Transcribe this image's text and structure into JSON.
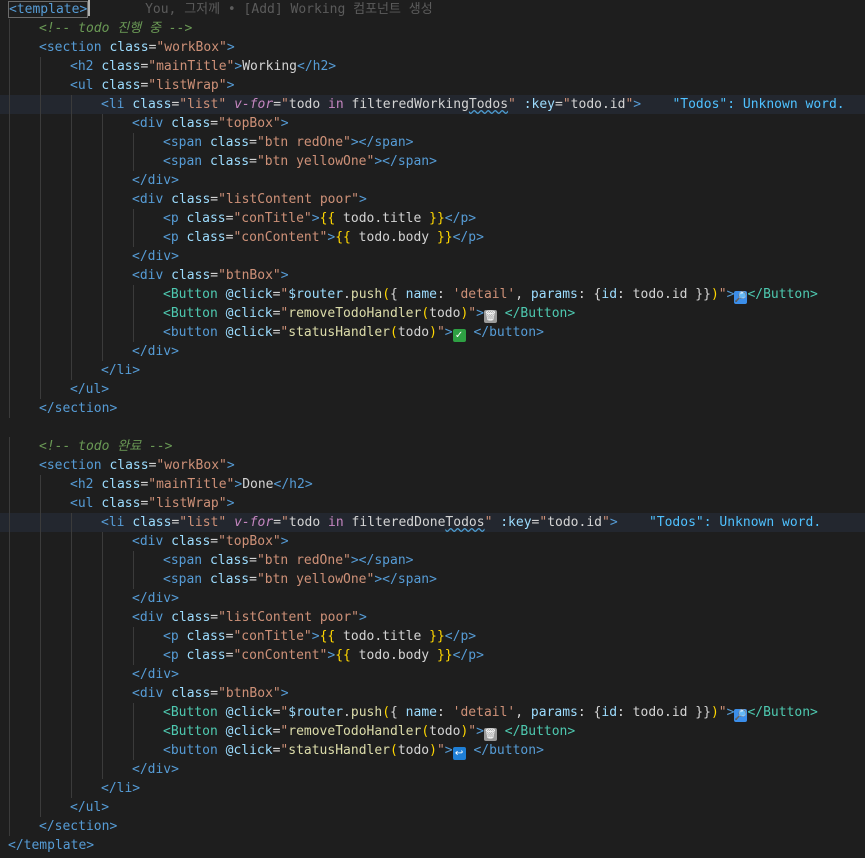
{
  "editor": {
    "blame": "You, 그저께 • [Add] Working 컴포넌트 생성",
    "diagnostic_working": "\"Todos\": Unknown word.",
    "diagnostic_done": "\"Todos\": Unknown word."
  },
  "lines": [
    {
      "indent": 0,
      "tokens": [
        [
          "tagb",
          "<template>"
        ],
        [
          "cursor",
          ""
        ],
        [
          "ghost",
          "       You, 그저께 • [Add] Working 컴포넌트 생성"
        ]
      ]
    },
    {
      "indent": 1,
      "tokens": [
        [
          "cmt",
          "<!-- todo 진행 중 -->"
        ]
      ]
    },
    {
      "indent": 1,
      "tokens": [
        [
          "tag",
          "<section"
        ],
        [
          "txt",
          " "
        ],
        [
          "attr",
          "class"
        ],
        [
          "txt",
          "="
        ],
        [
          "str",
          "\"workBox\""
        ],
        [
          "tag",
          ">"
        ]
      ]
    },
    {
      "indent": 2,
      "tokens": [
        [
          "tag",
          "<h2"
        ],
        [
          "txt",
          " "
        ],
        [
          "attr",
          "class"
        ],
        [
          "txt",
          "="
        ],
        [
          "str",
          "\"mainTitle\""
        ],
        [
          "tag",
          ">"
        ],
        [
          "txt",
          "Working"
        ],
        [
          "tag",
          "</h2>"
        ]
      ]
    },
    {
      "indent": 2,
      "tokens": [
        [
          "tag",
          "<ul"
        ],
        [
          "txt",
          " "
        ],
        [
          "attr",
          "class"
        ],
        [
          "txt",
          "="
        ],
        [
          "str",
          "\"listWrap\""
        ],
        [
          "tag",
          ">"
        ]
      ]
    },
    {
      "indent": 3,
      "hl": true,
      "tokens": [
        [
          "tag",
          "<li"
        ],
        [
          "txt",
          " "
        ],
        [
          "attr",
          "class"
        ],
        [
          "txt",
          "="
        ],
        [
          "str",
          "\"list\""
        ],
        [
          "txt",
          " "
        ],
        [
          "dir",
          "v-for"
        ],
        [
          "txt",
          "="
        ],
        [
          "str",
          "\""
        ],
        [
          "txt",
          "todo "
        ],
        [
          "kw",
          "in"
        ],
        [
          "txt",
          " filteredWorking"
        ],
        [
          "wavy",
          "Todos"
        ],
        [
          "str",
          "\""
        ],
        [
          "txt",
          " "
        ],
        [
          "attr",
          ":key"
        ],
        [
          "txt",
          "="
        ],
        [
          "str",
          "\""
        ],
        [
          "txt",
          "todo.id"
        ],
        [
          "str",
          "\""
        ],
        [
          "tag",
          ">"
        ],
        [
          "txt",
          "    "
        ],
        [
          "diag",
          "\"Todos\": Unknown word."
        ]
      ]
    },
    {
      "indent": 4,
      "tokens": [
        [
          "tag",
          "<div"
        ],
        [
          "txt",
          " "
        ],
        [
          "attr",
          "class"
        ],
        [
          "txt",
          "="
        ],
        [
          "str",
          "\"topBox\""
        ],
        [
          "tag",
          ">"
        ]
      ]
    },
    {
      "indent": 5,
      "tokens": [
        [
          "tag",
          "<span"
        ],
        [
          "txt",
          " "
        ],
        [
          "attr",
          "class"
        ],
        [
          "txt",
          "="
        ],
        [
          "str",
          "\"btn redOne\""
        ],
        [
          "tag",
          "></span>"
        ]
      ]
    },
    {
      "indent": 5,
      "tokens": [
        [
          "tag",
          "<span"
        ],
        [
          "txt",
          " "
        ],
        [
          "attr",
          "class"
        ],
        [
          "txt",
          "="
        ],
        [
          "str",
          "\"btn yellowOne\""
        ],
        [
          "tag",
          "></span>"
        ]
      ]
    },
    {
      "indent": 4,
      "tokens": [
        [
          "tag",
          "</div>"
        ]
      ]
    },
    {
      "indent": 4,
      "tokens": [
        [
          "tag",
          "<div"
        ],
        [
          "txt",
          " "
        ],
        [
          "attr",
          "class"
        ],
        [
          "txt",
          "="
        ],
        [
          "str",
          "\"listContent poor\""
        ],
        [
          "tag",
          ">"
        ]
      ]
    },
    {
      "indent": 5,
      "tokens": [
        [
          "tag",
          "<p"
        ],
        [
          "txt",
          " "
        ],
        [
          "attr",
          "class"
        ],
        [
          "txt",
          "="
        ],
        [
          "str",
          "\"conTitle\""
        ],
        [
          "tag",
          ">"
        ],
        [
          "brace",
          "{{"
        ],
        [
          "txt",
          " todo.title "
        ],
        [
          "brace",
          "}}"
        ],
        [
          "tag",
          "</p>"
        ]
      ]
    },
    {
      "indent": 5,
      "tokens": [
        [
          "tag",
          "<p"
        ],
        [
          "txt",
          " "
        ],
        [
          "attr",
          "class"
        ],
        [
          "txt",
          "="
        ],
        [
          "str",
          "\"conContent\""
        ],
        [
          "tag",
          ">"
        ],
        [
          "brace",
          "{{"
        ],
        [
          "txt",
          " todo.body "
        ],
        [
          "brace",
          "}}"
        ],
        [
          "tag",
          "</p>"
        ]
      ]
    },
    {
      "indent": 4,
      "tokens": [
        [
          "tag",
          "</div>"
        ]
      ]
    },
    {
      "indent": 4,
      "tokens": [
        [
          "tag",
          "<div"
        ],
        [
          "txt",
          " "
        ],
        [
          "attr",
          "class"
        ],
        [
          "txt",
          "="
        ],
        [
          "str",
          "\"btnBox\""
        ],
        [
          "tag",
          ">"
        ]
      ]
    },
    {
      "indent": 5,
      "tokens": [
        [
          "btag",
          "<Button"
        ],
        [
          "txt",
          " "
        ],
        [
          "attr",
          "@click"
        ],
        [
          "txt",
          "="
        ],
        [
          "str",
          "\""
        ],
        [
          "var",
          "$router"
        ],
        [
          "txt",
          "."
        ],
        [
          "fn",
          "push"
        ],
        [
          "brace",
          "("
        ],
        [
          "txt",
          "{ "
        ],
        [
          "attr",
          "name"
        ],
        [
          "txt",
          ": "
        ],
        [
          "str",
          "'detail'"
        ],
        [
          "txt",
          ", "
        ],
        [
          "attr",
          "params"
        ],
        [
          "txt",
          ": {"
        ],
        [
          "attr",
          "id"
        ],
        [
          "txt",
          ": todo.id }}"
        ],
        [
          "brace",
          ")"
        ],
        [
          "str",
          "\""
        ],
        [
          "tag",
          ">"
        ],
        [
          "icon:#3b8eea",
          "🔎"
        ],
        [
          "btag",
          "</Button>"
        ]
      ]
    },
    {
      "indent": 5,
      "tokens": [
        [
          "btag",
          "<Button"
        ],
        [
          "txt",
          " "
        ],
        [
          "attr",
          "@click"
        ],
        [
          "txt",
          "="
        ],
        [
          "str",
          "\""
        ],
        [
          "fn",
          "removeTodoHandler"
        ],
        [
          "brace",
          "("
        ],
        [
          "txt",
          "todo"
        ],
        [
          "brace",
          ")"
        ],
        [
          "str",
          "\""
        ],
        [
          "tag",
          ">"
        ],
        [
          "icon:#9a9a9a",
          "🗑"
        ],
        [
          "txt",
          " "
        ],
        [
          "btag",
          "</Button>"
        ]
      ]
    },
    {
      "indent": 5,
      "tokens": [
        [
          "tag",
          "<button"
        ],
        [
          "txt",
          " "
        ],
        [
          "attr",
          "@click"
        ],
        [
          "txt",
          "="
        ],
        [
          "str",
          "\""
        ],
        [
          "fn",
          "statusHandler"
        ],
        [
          "brace",
          "("
        ],
        [
          "txt",
          "todo"
        ],
        [
          "brace",
          ")"
        ],
        [
          "str",
          "\""
        ],
        [
          "tag",
          ">"
        ],
        [
          "icon:#2ea043",
          "✓"
        ],
        [
          "txt",
          " "
        ],
        [
          "tag",
          "</button>"
        ]
      ]
    },
    {
      "indent": 4,
      "tokens": [
        [
          "tag",
          "</div>"
        ]
      ]
    },
    {
      "indent": 3,
      "tokens": [
        [
          "tag",
          "</li>"
        ]
      ]
    },
    {
      "indent": 2,
      "tokens": [
        [
          "tag",
          "</ul>"
        ]
      ]
    },
    {
      "indent": 1,
      "tokens": [
        [
          "tag",
          "</section>"
        ]
      ]
    },
    {
      "indent": 0,
      "tokens": []
    },
    {
      "indent": 1,
      "tokens": [
        [
          "cmt",
          "<!-- todo 완료 -->"
        ]
      ]
    },
    {
      "indent": 1,
      "tokens": [
        [
          "tag",
          "<section"
        ],
        [
          "txt",
          " "
        ],
        [
          "attr",
          "class"
        ],
        [
          "txt",
          "="
        ],
        [
          "str",
          "\"workBox\""
        ],
        [
          "tag",
          ">"
        ]
      ]
    },
    {
      "indent": 2,
      "tokens": [
        [
          "tag",
          "<h2"
        ],
        [
          "txt",
          " "
        ],
        [
          "attr",
          "class"
        ],
        [
          "txt",
          "="
        ],
        [
          "str",
          "\"mainTitle\""
        ],
        [
          "tag",
          ">"
        ],
        [
          "txt",
          "Done"
        ],
        [
          "tag",
          "</h2>"
        ]
      ]
    },
    {
      "indent": 2,
      "tokens": [
        [
          "tag",
          "<ul"
        ],
        [
          "txt",
          " "
        ],
        [
          "attr",
          "class"
        ],
        [
          "txt",
          "="
        ],
        [
          "str",
          "\"listWrap\""
        ],
        [
          "tag",
          ">"
        ]
      ]
    },
    {
      "indent": 3,
      "hl": true,
      "tokens": [
        [
          "tag",
          "<li"
        ],
        [
          "txt",
          " "
        ],
        [
          "attr",
          "class"
        ],
        [
          "txt",
          "="
        ],
        [
          "str",
          "\"list\""
        ],
        [
          "txt",
          " "
        ],
        [
          "dir",
          "v-for"
        ],
        [
          "txt",
          "="
        ],
        [
          "str",
          "\""
        ],
        [
          "txt",
          "todo "
        ],
        [
          "kw",
          "in"
        ],
        [
          "txt",
          " filteredDone"
        ],
        [
          "wavy",
          "Todos"
        ],
        [
          "str",
          "\""
        ],
        [
          "txt",
          " "
        ],
        [
          "attr",
          ":key"
        ],
        [
          "txt",
          "="
        ],
        [
          "str",
          "\""
        ],
        [
          "txt",
          "todo.id"
        ],
        [
          "str",
          "\""
        ],
        [
          "tag",
          ">"
        ],
        [
          "txt",
          "    "
        ],
        [
          "diag",
          "\"Todos\": Unknown word."
        ]
      ]
    },
    {
      "indent": 4,
      "tokens": [
        [
          "tag",
          "<div"
        ],
        [
          "txt",
          " "
        ],
        [
          "attr",
          "class"
        ],
        [
          "txt",
          "="
        ],
        [
          "str",
          "\"topBox\""
        ],
        [
          "tag",
          ">"
        ]
      ]
    },
    {
      "indent": 5,
      "tokens": [
        [
          "tag",
          "<span"
        ],
        [
          "txt",
          " "
        ],
        [
          "attr",
          "class"
        ],
        [
          "txt",
          "="
        ],
        [
          "str",
          "\"btn redOne\""
        ],
        [
          "tag",
          "></span>"
        ]
      ]
    },
    {
      "indent": 5,
      "tokens": [
        [
          "tag",
          "<span"
        ],
        [
          "txt",
          " "
        ],
        [
          "attr",
          "class"
        ],
        [
          "txt",
          "="
        ],
        [
          "str",
          "\"btn yellowOne\""
        ],
        [
          "tag",
          "></span>"
        ]
      ]
    },
    {
      "indent": 4,
      "tokens": [
        [
          "tag",
          "</div>"
        ]
      ]
    },
    {
      "indent": 4,
      "tokens": [
        [
          "tag",
          "<div"
        ],
        [
          "txt",
          " "
        ],
        [
          "attr",
          "class"
        ],
        [
          "txt",
          "="
        ],
        [
          "str",
          "\"listContent poor\""
        ],
        [
          "tag",
          ">"
        ]
      ]
    },
    {
      "indent": 5,
      "tokens": [
        [
          "tag",
          "<p"
        ],
        [
          "txt",
          " "
        ],
        [
          "attr",
          "class"
        ],
        [
          "txt",
          "="
        ],
        [
          "str",
          "\"conTitle\""
        ],
        [
          "tag",
          ">"
        ],
        [
          "brace",
          "{{"
        ],
        [
          "txt",
          " todo.title "
        ],
        [
          "brace",
          "}}"
        ],
        [
          "tag",
          "</p>"
        ]
      ]
    },
    {
      "indent": 5,
      "tokens": [
        [
          "tag",
          "<p"
        ],
        [
          "txt",
          " "
        ],
        [
          "attr",
          "class"
        ],
        [
          "txt",
          "="
        ],
        [
          "str",
          "\"conContent\""
        ],
        [
          "tag",
          ">"
        ],
        [
          "brace",
          "{{"
        ],
        [
          "txt",
          " todo.body "
        ],
        [
          "brace",
          "}}"
        ],
        [
          "tag",
          "</p>"
        ]
      ]
    },
    {
      "indent": 4,
      "tokens": [
        [
          "tag",
          "</div>"
        ]
      ]
    },
    {
      "indent": 4,
      "tokens": [
        [
          "tag",
          "<div"
        ],
        [
          "txt",
          " "
        ],
        [
          "attr",
          "class"
        ],
        [
          "txt",
          "="
        ],
        [
          "str",
          "\"btnBox\""
        ],
        [
          "tag",
          ">"
        ]
      ]
    },
    {
      "indent": 5,
      "tokens": [
        [
          "btag",
          "<Button"
        ],
        [
          "txt",
          " "
        ],
        [
          "attr",
          "@click"
        ],
        [
          "txt",
          "="
        ],
        [
          "str",
          "\""
        ],
        [
          "var",
          "$router"
        ],
        [
          "txt",
          "."
        ],
        [
          "fn",
          "push"
        ],
        [
          "brace",
          "("
        ],
        [
          "txt",
          "{ "
        ],
        [
          "attr",
          "name"
        ],
        [
          "txt",
          ": "
        ],
        [
          "str",
          "'detail'"
        ],
        [
          "txt",
          ", "
        ],
        [
          "attr",
          "params"
        ],
        [
          "txt",
          ": {"
        ],
        [
          "attr",
          "id"
        ],
        [
          "txt",
          ": todo.id }}"
        ],
        [
          "brace",
          ")"
        ],
        [
          "str",
          "\""
        ],
        [
          "tag",
          ">"
        ],
        [
          "icon:#3b8eea",
          "🔎"
        ],
        [
          "btag",
          "</Button>"
        ]
      ]
    },
    {
      "indent": 5,
      "tokens": [
        [
          "btag",
          "<Button"
        ],
        [
          "txt",
          " "
        ],
        [
          "attr",
          "@click"
        ],
        [
          "txt",
          "="
        ],
        [
          "str",
          "\""
        ],
        [
          "fn",
          "removeTodoHandler"
        ],
        [
          "brace",
          "("
        ],
        [
          "txt",
          "todo"
        ],
        [
          "brace",
          ")"
        ],
        [
          "str",
          "\""
        ],
        [
          "tag",
          ">"
        ],
        [
          "icon:#9a9a9a",
          "🗑"
        ],
        [
          "txt",
          " "
        ],
        [
          "btag",
          "</Button>"
        ]
      ]
    },
    {
      "indent": 5,
      "tokens": [
        [
          "tag",
          "<button"
        ],
        [
          "txt",
          " "
        ],
        [
          "attr",
          "@click"
        ],
        [
          "txt",
          "="
        ],
        [
          "str",
          "\""
        ],
        [
          "fn",
          "statusHandler"
        ],
        [
          "brace",
          "("
        ],
        [
          "txt",
          "todo"
        ],
        [
          "brace",
          ")"
        ],
        [
          "str",
          "\""
        ],
        [
          "tag",
          ">"
        ],
        [
          "icon:#1f7fd6",
          "↩"
        ],
        [
          "txt",
          " "
        ],
        [
          "tag",
          "</button>"
        ]
      ]
    },
    {
      "indent": 4,
      "tokens": [
        [
          "tag",
          "</div>"
        ]
      ]
    },
    {
      "indent": 3,
      "tokens": [
        [
          "tag",
          "</li>"
        ]
      ]
    },
    {
      "indent": 2,
      "tokens": [
        [
          "tag",
          "</ul>"
        ]
      ]
    },
    {
      "indent": 1,
      "tokens": [
        [
          "tag",
          "</section>"
        ]
      ]
    },
    {
      "indent": 0,
      "tokens": [
        [
          "tag",
          "</template>"
        ]
      ]
    }
  ]
}
